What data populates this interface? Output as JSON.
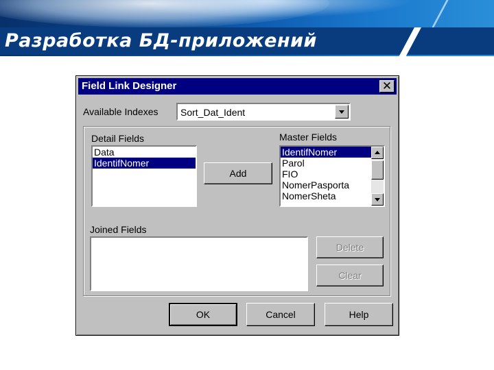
{
  "slide": {
    "title": "Разработка БД-приложений"
  },
  "dialog": {
    "title": "Field Link Designer",
    "available_indexes_label": "Available Indexes",
    "available_indexes_value": "Sort_Dat_Ident",
    "detail_fields_label": "Detail Fields",
    "detail_fields": [
      "Data",
      "IdentifNomer"
    ],
    "detail_selected": "IdentifNomer",
    "master_fields_label": "Master Fields",
    "master_fields": [
      "IdentifNomer",
      "Parol",
      "FIO",
      "NomerPasporta",
      "NomerSheta"
    ],
    "master_selected": "IdentifNomer",
    "joined_fields_label": "Joined Fields",
    "buttons": {
      "add": "Add",
      "delete": "Delete",
      "clear": "Clear",
      "ok": "OK",
      "cancel": "Cancel",
      "help": "Help"
    },
    "icons": {
      "close": "close-icon",
      "dropdown": "chevron-down-icon",
      "scroll_up": "arrow-up-icon",
      "scroll_down": "arrow-down-icon"
    }
  }
}
